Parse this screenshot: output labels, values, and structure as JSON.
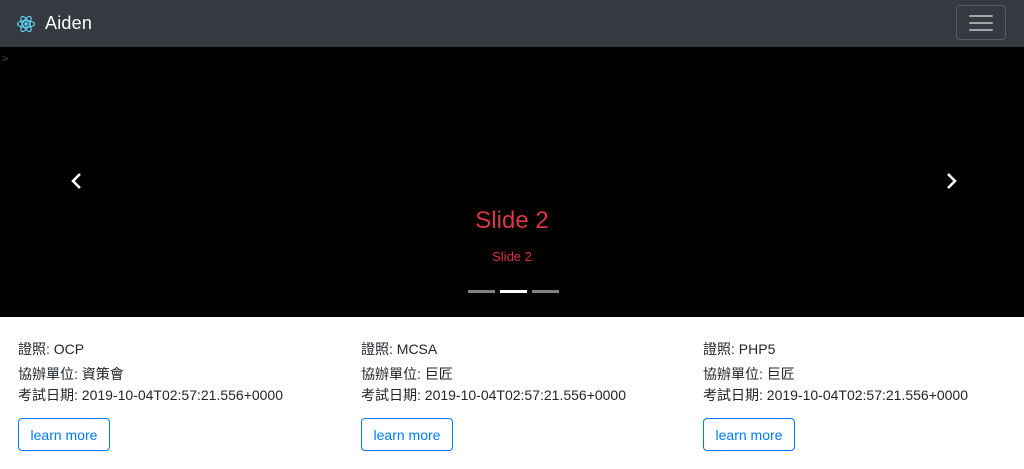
{
  "navbar": {
    "brand": "Aiden",
    "logo_icon": "react-atom-icon",
    "logo_color": "#61dafb",
    "toggler_icon": "hamburger-menu-icon"
  },
  "carousel": {
    "stray_text": ">",
    "caption_title": "Slide 2",
    "caption_text": "Slide 2",
    "caption_color": "#dc3545",
    "indicators": [
      false,
      true,
      false
    ],
    "prev_icon": "chevron-left-icon",
    "next_icon": "chevron-right-icon"
  },
  "cards": [
    {
      "cert": "證照: OCP",
      "org": "協辦單位: 資策會",
      "date": "考試日期: 2019-10-04T02:57:21.556+0000",
      "button": "learn more"
    },
    {
      "cert": "證照: MCSA",
      "org": "協辦單位: 巨匠",
      "date": "考試日期: 2019-10-04T02:57:21.556+0000",
      "button": "learn more"
    },
    {
      "cert": "證照: PHP5",
      "org": "協辦單位: 巨匠",
      "date": "考試日期: 2019-10-04T02:57:21.556+0000",
      "button": "learn more"
    }
  ]
}
